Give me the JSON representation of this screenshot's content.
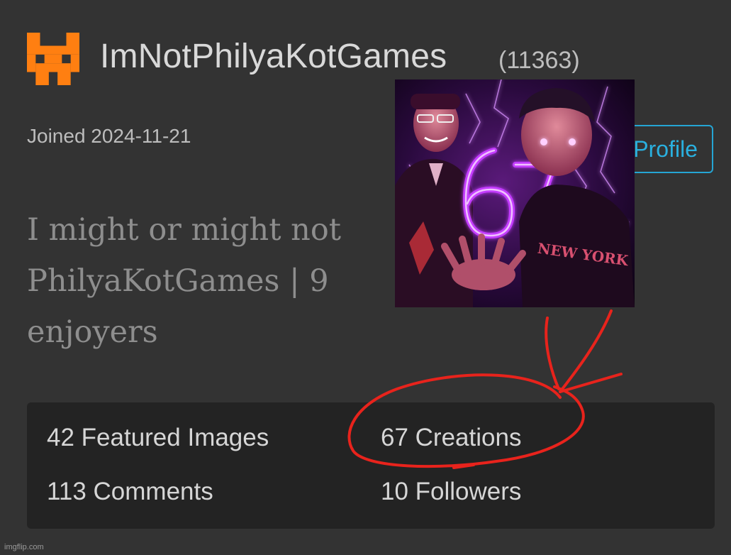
{
  "profile": {
    "username": "ImNotPhilyaKotGames",
    "points": "(11363)",
    "joined": "Joined 2024-11-21",
    "profile_button_label": "Profile",
    "bio_lines": [
      "I might or might not",
      "PhilyaKotGames | 9",
      "enjoyers"
    ]
  },
  "stats": {
    "featured_images": "42 Featured Images",
    "creations": "67 Creations",
    "comments": "113 Comments",
    "followers": "10 Followers"
  },
  "overlay_image": {
    "number_text": "67",
    "shirt_text": "NEW YORK"
  },
  "watermark": "imgflip.com",
  "colors": {
    "background": "#333333",
    "stats_panel": "#232323",
    "accent_blue": "#2ab0df",
    "logo_orange": "#ff7f11",
    "annotation_red": "#e8231c",
    "neon_purple": "#c43cff"
  },
  "icons": {
    "logo": "pixel-cat-logo-icon"
  }
}
